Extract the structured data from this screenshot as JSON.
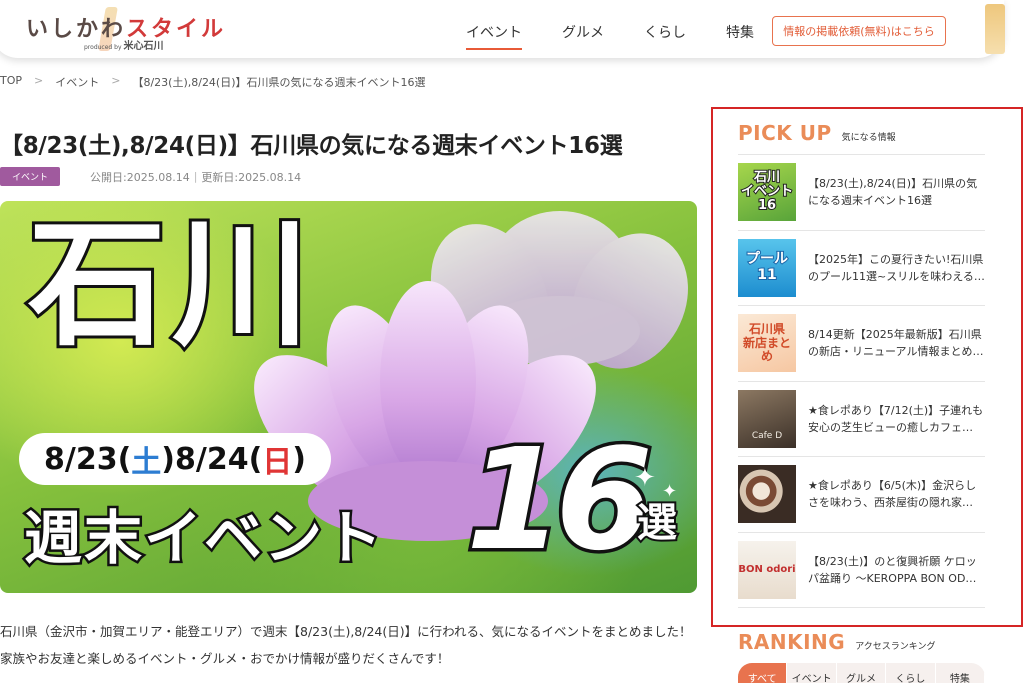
{
  "header": {
    "logo_main_a": "いしかわ",
    "logo_main_b": "スタイル",
    "logo_produced": "produced by",
    "logo_brand": "米心石川",
    "nav": [
      "イベント",
      "グルメ",
      "くらし",
      "特集"
    ],
    "active_nav": "イベント",
    "request_button": "情報の掲載依頼(無料)はこちら"
  },
  "breadcrumb": [
    "TOP",
    "イベント",
    "【8/23(土),8/24(日)】石川県の気になる週末イベント16選"
  ],
  "breadcrumb_separator": ">",
  "article": {
    "title": "【8/23(土),8/24(日)】石川県の気になる週末イベント16選",
    "category": "イベント",
    "published": "公開日:2025.08.14",
    "updated": "更新日:2025.08.14",
    "meta_divider": "|",
    "hero": {
      "title": "石川",
      "date_a": "8/23(",
      "date_sat": "土",
      "date_b": ")8/24(",
      "date_sun": "日",
      "date_c": ")",
      "weekend": "週末イベント",
      "number": "16",
      "sen": "選"
    },
    "intro": "石川県（金沢市・加賀エリア・能登エリア）で週末【8/23(土),8/24(日)】に行われる、気になるイベントをまとめました！家族やお友達と楽しめるイベント・グルメ・おでかけ情報が盛りだくさんです！"
  },
  "pickup": {
    "title": "PICK UP",
    "subtitle": "気になる情報",
    "items": [
      {
        "thumb_label": "石川\nイベント16",
        "text": "【8/23(土),8/24(日)】石川県の気になる週末イベント16選"
      },
      {
        "thumb_label": "プール11",
        "text": "【2025年】この夏行きたい!石川県のプール11選~スリルを味わえる大型スライダーから"
      },
      {
        "thumb_label": "石川県\n新店まとめ",
        "text": "8/14更新【2025年最新版】石川県の新店・リニューアル情報まとめ｜…"
      },
      {
        "thumb_label": "Cafe D",
        "text": "★食レポあり【7/12(土)】子連れも安心の芝生ビューの癒しカフェ…"
      },
      {
        "thumb_label": "",
        "text": "★食レポあり【6/5(木)】金沢らしさを味わう、西茶屋街の隠れ家…"
      },
      {
        "thumb_label": "BON odori",
        "text": "【8/23(土)】のと復興祈願 ケロッパ盆踊り ～KEROPPA BON ODORI～"
      }
    ]
  },
  "ranking": {
    "title": "RANKING",
    "subtitle": "アクセスランキング",
    "tabs": [
      "すべて",
      "イベント",
      "グルメ",
      "くらし",
      "特集"
    ],
    "active_tab": "すべて"
  },
  "colors": {
    "accent_orange": "#e8734e",
    "pickup_heading": "#ea8c58",
    "highlight_box": "#d52525",
    "category_badge": "#a05a9e"
  }
}
